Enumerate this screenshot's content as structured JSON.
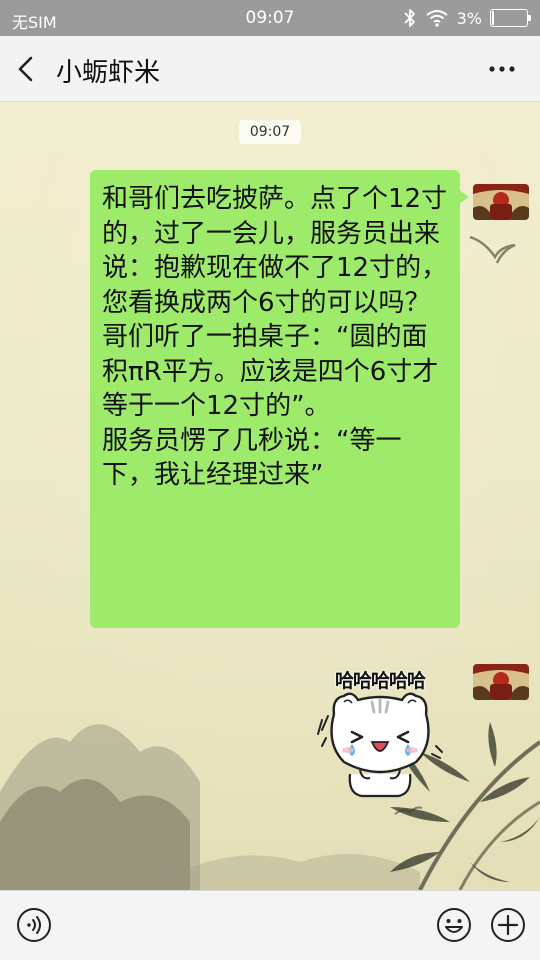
{
  "status_bar": {
    "carrier": "无SIM",
    "time": "09:07",
    "battery_text": "3%",
    "battery_level": 0.03,
    "icons": [
      "bluetooth-icon",
      "wifi-icon",
      "battery-icon"
    ]
  },
  "header": {
    "title": "小蛎虾米",
    "back_icon": "chevron-left-icon",
    "more_icon": "more-dots-icon"
  },
  "chat": {
    "timestamp": "09:07",
    "messages": [
      {
        "sender": "self",
        "type": "text",
        "text": "和哥们去吃披萨。点了个12寸的，过了一会儿，服务员出来说：抱歉现在做不了12寸的，您看换成两个6寸的可以吗？\n哥们听了一拍桌子：“圆的面积πR平方。应该是四个6寸才等于一个12寸的”。\n服务员愣了几秒说：“等一下，我让经理过来”"
      },
      {
        "sender": "self",
        "type": "sticker",
        "caption": "哈哈哈哈哈",
        "sticker_icon": "laughing-cat-sticker"
      }
    ]
  },
  "input_bar": {
    "voice_icon": "voice-icon",
    "emoji_icon": "emoji-icon",
    "plus_icon": "plus-icon"
  },
  "colors": {
    "status_bar": "#9b9b9b",
    "header_bg": "#f3f3f3",
    "bubble_self": "#9eea6a",
    "chat_bg": "#efecca"
  }
}
